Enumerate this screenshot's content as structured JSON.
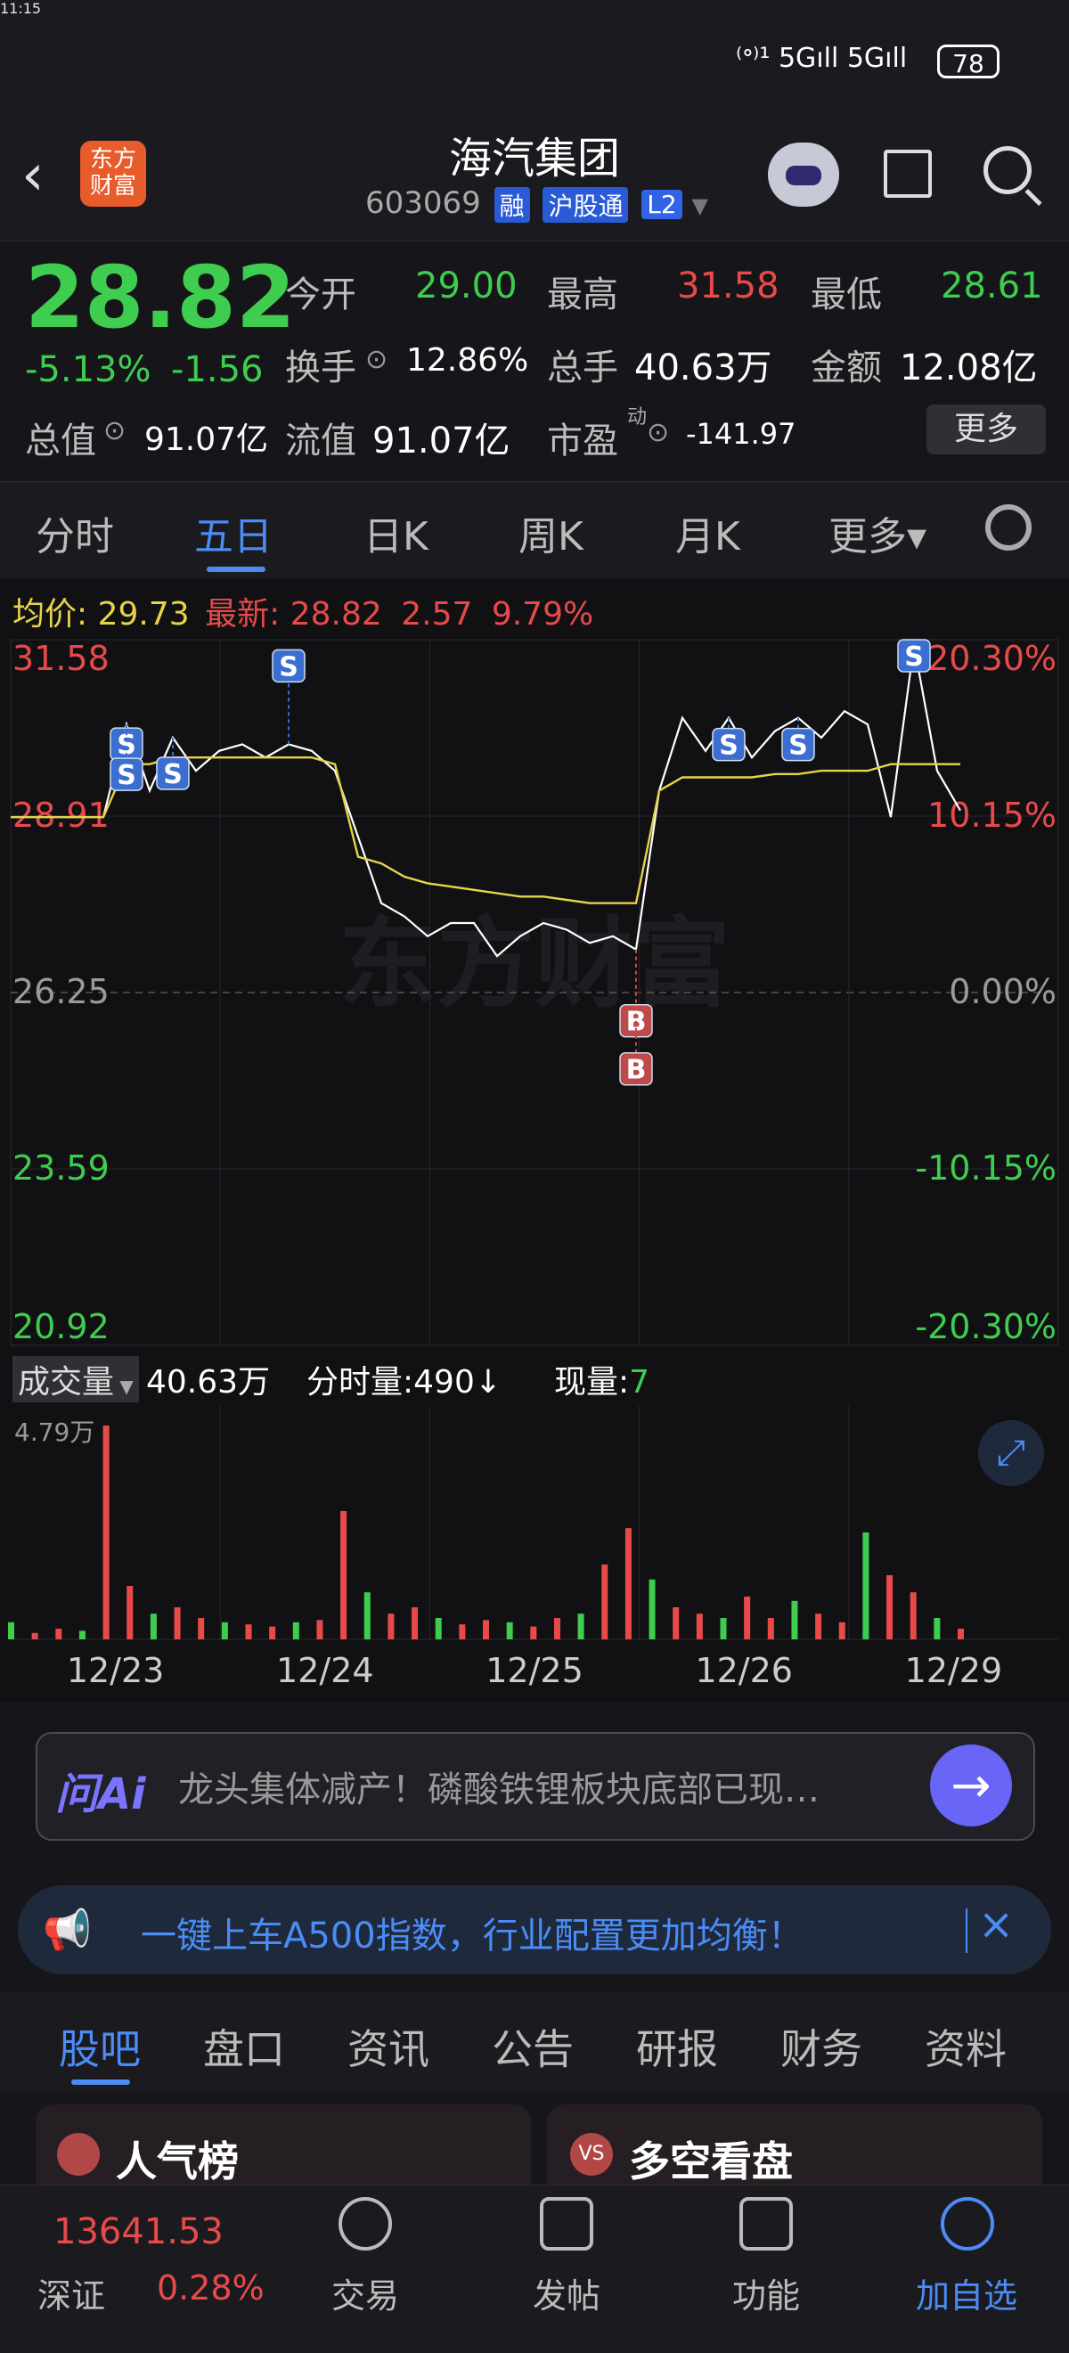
{
  "status": {
    "time": "11:15",
    "signal": "⁽ᐤ⁾¹ 5Gıll 5Gıll",
    "battery": "78"
  },
  "header": {
    "back_glyph": "‹",
    "logo": "东方财富",
    "title": "海汽集团",
    "code": "603069",
    "tags": [
      "融",
      "沪股通",
      "L2"
    ]
  },
  "quote": {
    "price": "28.82",
    "change_pct": "-5.13%",
    "change_amt": "-1.56",
    "open_label": "今开",
    "open": "29.00",
    "high_label": "最高",
    "high": "31.58",
    "low_label": "最低",
    "low": "28.61",
    "turnover_label": "换手",
    "turnover": "12.86%",
    "volume_label": "总手",
    "volume": "40.63万",
    "amount_label": "金额",
    "amount": "12.08亿",
    "mcap_label": "总值",
    "mcap": "91.07亿",
    "float_label": "流值",
    "float": "91.07亿",
    "pe_label": "市盈",
    "pe_sup": "动",
    "pe": "-141.97",
    "more": "更多"
  },
  "tabs": [
    "分时",
    "五日",
    "日K",
    "周K",
    "月K",
    "更多▾"
  ],
  "active_tab": "五日",
  "chart_info": {
    "avg_label": "均价:",
    "avg": "29.73",
    "latest_label": "最新:",
    "latest": "28.82",
    "chg": "2.57",
    "pct": "9.79%"
  },
  "chart_data": {
    "type": "line",
    "x": [
      "12/23",
      "12/24",
      "12/25",
      "12/26",
      "12/29"
    ],
    "y_left": [
      "31.58",
      "28.91",
      "26.25",
      "23.59",
      "20.92"
    ],
    "y_right": [
      "20.30%",
      "10.15%",
      "0.00%",
      "-10.15%",
      "-20.30%"
    ],
    "ylim": [
      20.92,
      31.58
    ],
    "prev_close": 26.25,
    "series": [
      {
        "values": [
          28.9,
          28.9,
          28.9,
          28.9,
          28.9,
          30.3,
          29.3,
          30.1,
          29.6,
          29.9,
          30.0,
          29.8,
          30.0,
          29.9,
          29.6,
          28.6,
          27.6,
          27.4,
          27.1,
          27.3,
          27.3,
          26.8,
          27.1,
          27.3,
          27.2,
          27.0,
          27.1,
          26.9,
          29.3,
          30.4,
          29.9,
          30.4,
          29.8,
          30.2,
          30.4,
          30.1,
          30.5,
          30.3,
          28.9,
          31.5,
          29.6,
          29.0
        ]
      },
      {
        "values": [
          28.9,
          28.9,
          28.9,
          28.9,
          28.9,
          29.7,
          29.7,
          29.8,
          29.8,
          29.8,
          29.8,
          29.8,
          29.8,
          29.8,
          29.7,
          28.3,
          28.2,
          28.0,
          27.9,
          27.85,
          27.8,
          27.75,
          27.7,
          27.7,
          27.65,
          27.6,
          27.6,
          27.6,
          29.3,
          29.5,
          29.5,
          29.5,
          29.5,
          29.55,
          29.55,
          29.6,
          29.6,
          29.6,
          29.7,
          29.7,
          29.7,
          29.7
        ]
      }
    ],
    "vol_label": "成交量",
    "vol_total": "40.63万",
    "vol_max": "4.79万",
    "tick_label": "分时量:",
    "tick_vol": "490↓",
    "now_label": "现量:",
    "now_vol": "7",
    "volume": [
      0.08,
      0.03,
      0.05,
      0.04,
      1.0,
      0.25,
      0.12,
      0.15,
      0.1,
      0.08,
      0.07,
      0.06,
      0.08,
      0.09,
      0.6,
      0.22,
      0.12,
      0.15,
      0.1,
      0.07,
      0.09,
      0.08,
      0.06,
      0.1,
      0.12,
      0.35,
      0.52,
      0.28,
      0.15,
      0.12,
      0.1,
      0.2,
      0.1,
      0.18,
      0.12,
      0.08,
      0.5,
      0.3,
      0.22,
      0.1,
      0.05
    ],
    "markers": [
      "S",
      "S",
      "S",
      "S",
      "S",
      "S",
      "S",
      "B",
      "B"
    ]
  },
  "ai": {
    "logo": "问Ai",
    "text": "龙头集体减产！磷酸铁锂板块底部已现…",
    "go": "→"
  },
  "banner": {
    "icon": "📢",
    "text": "一键上车A500指数，行业配置更加均衡！",
    "close": "×"
  },
  "sub_tabs": [
    "股吧",
    "盘口",
    "资讯",
    "公告",
    "研报",
    "财务",
    "资料"
  ],
  "cards": [
    "人气榜",
    "多空看盘"
  ],
  "bottom": {
    "index_value": "13641.53",
    "index_name": "深证",
    "index_pct": "0.28%",
    "items": [
      "交易",
      "发帖",
      "功能",
      "加自选"
    ]
  },
  "colors": {
    "up": "#e84a4a",
    "down": "#3fcd4f",
    "accent": "#4b8cf6",
    "price_line": "#ffffff",
    "avg_line": "#e8d34a"
  }
}
